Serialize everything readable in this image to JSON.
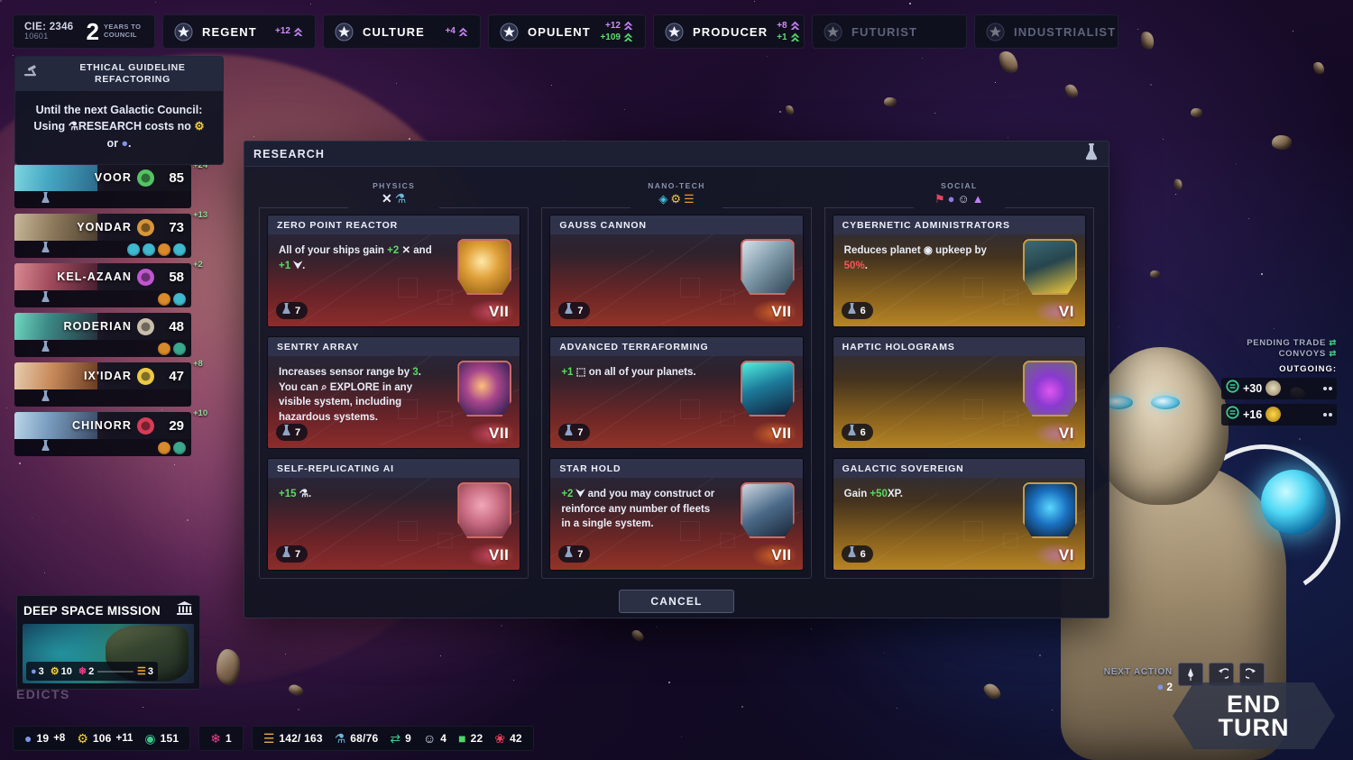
{
  "top_bar": {
    "turn_box": {
      "cie_label": "CIE: 2346",
      "cie_sub": "10601",
      "years_number": "2",
      "years_label_line1": "YEARS TO",
      "years_label_line2": "COUNCIL"
    },
    "seats": [
      {
        "label": "REGENT",
        "gain_primary": "+12",
        "gain_secondary": "",
        "active": true
      },
      {
        "label": "CULTURE",
        "gain_primary": "+4",
        "gain_secondary": "",
        "active": true
      },
      {
        "label": "OPULENT",
        "gain_primary": "+12",
        "gain_secondary": "+109",
        "active": true
      },
      {
        "label": "PRODUCER",
        "gain_primary": "+8",
        "gain_secondary": "+1",
        "active": true
      },
      {
        "label": "FUTURIST",
        "gain_primary": "",
        "gain_secondary": "",
        "active": false
      },
      {
        "label": "INDUSTRIALIST",
        "gain_primary": "",
        "gain_secondary": "",
        "active": false
      }
    ]
  },
  "ethical_panel": {
    "icon": "gavel-icon",
    "title": "ETHICAL GUIDELINE REFACTORING",
    "line1": "Until the next Galactic Council:",
    "line2_pre": "Using ",
    "line2_token": "RESEARCH",
    "line2_post": " costs no ",
    "line3": "or"
  },
  "civilizations": [
    {
      "name": "VOOR",
      "score": "85",
      "delta": "+24",
      "emblem_color": "#5ad36a",
      "portrait": "voor",
      "icons": []
    },
    {
      "name": "YONDAR",
      "score": "73",
      "delta": "+13",
      "emblem_color": "#e8a23c",
      "portrait": "yondar",
      "icons": [
        "#3fb9cf",
        "#3fb9cf",
        "#d98b2c",
        "#3fb9cf"
      ]
    },
    {
      "name": "KEL-AZAAN",
      "score": "58",
      "delta": "+2",
      "emblem_color": "#d05ce0",
      "portrait": "kelazaan",
      "icons": [
        "#d98b2c",
        "#3fb9cf"
      ]
    },
    {
      "name": "RODERIAN",
      "score": "48",
      "delta": "",
      "emblem_color": "#d9cdb5",
      "portrait": "roderian",
      "icons": [
        "#d98b2c",
        "#3aa88c"
      ]
    },
    {
      "name": "IX'IDAR",
      "score": "47",
      "delta": "+8",
      "emblem_color": "#ffd94a",
      "portrait": "ixidar",
      "icons": []
    },
    {
      "name": "CHINORR",
      "score": "29",
      "delta": "+10",
      "emblem_color": "#e8405c",
      "portrait": "chinorr",
      "icons": [
        "#d98b2c",
        "#3aa88c"
      ]
    }
  ],
  "research": {
    "header_title": "RESEARCH",
    "header_icon": "flask-icon",
    "cancel_label": "CANCEL",
    "columns": [
      {
        "label": "PHYSICS",
        "icons": [
          "attack-icon",
          "flask-icon"
        ],
        "theme": "physics",
        "cards": [
          {
            "title": "ZERO POINT REACTOR",
            "desc_parts": [
              {
                "t": "All of your ships gain ",
                "c": "w"
              },
              {
                "t": "+2",
                "c": "g"
              },
              {
                "t": " ✕ and ",
                "c": "w"
              },
              {
                "t": "+1",
                "c": "g"
              },
              {
                "t": " ⮟.",
                "c": "w"
              }
            ],
            "cost": "7",
            "tier": "VII",
            "art": "atom-icon"
          },
          {
            "title": "SENTRY ARRAY",
            "desc_parts": [
              {
                "t": "Increases sensor range by ",
                "c": "w"
              },
              {
                "t": "3",
                "c": "g"
              },
              {
                "t": ". You can ⌕ EXPLORE in any visible system, including hazardous systems.",
                "c": "w"
              }
            ],
            "cost": "7",
            "tier": "VII",
            "art": "galaxy-icon"
          },
          {
            "title": "SELF-REPLICATING AI",
            "desc_parts": [
              {
                "t": "+15",
                "c": "g"
              },
              {
                "t": " ⚗.",
                "c": "w"
              }
            ],
            "cost": "7",
            "tier": "VII",
            "art": "brain-icon"
          }
        ]
      },
      {
        "label": "NANO-TECH",
        "icons": [
          "droplet-icon",
          "gear-icon",
          "wave-icon"
        ],
        "theme": "nano",
        "cards": [
          {
            "title": "GAUSS CANNON",
            "desc_parts": [],
            "cost": "7",
            "tier": "VII",
            "art": "cannon-icon"
          },
          {
            "title": "ADVANCED TERRAFORMING",
            "desc_parts": [
              {
                "t": "+1",
                "c": "g"
              },
              {
                "t": " ⬚ on all of your planets.",
                "c": "w"
              }
            ],
            "cost": "7",
            "tier": "VII",
            "art": "terraform-icon"
          },
          {
            "title": "STAR HOLD",
            "desc_parts": [
              {
                "t": "+2",
                "c": "g"
              },
              {
                "t": " ⮟ and you may construct or reinforce any number of fleets in a single system.",
                "c": "w"
              }
            ],
            "cost": "7",
            "tier": "VII",
            "art": "starbase-icon"
          }
        ]
      },
      {
        "label": "SOCIAL",
        "icons": [
          "flag-icon",
          "mask-icon",
          "theater-icon",
          "influence-icon"
        ],
        "theme": "social",
        "cards": [
          {
            "title": "CYBERNETIC ADMINISTRATORS",
            "desc_parts": [
              {
                "t": "Reduces planet ◉ upkeep by ",
                "c": "w"
              },
              {
                "t": "50%",
                "c": "r"
              },
              {
                "t": ".",
                "c": "w"
              }
            ],
            "cost": "6",
            "tier": "VI",
            "art": "administrators-icon"
          },
          {
            "title": "HAPTIC HOLOGRAMS",
            "desc_parts": [],
            "cost": "6",
            "tier": "VI",
            "art": "hologram-icon"
          },
          {
            "title": "GALACTIC SOVEREIGN",
            "desc_parts": [
              {
                "t": "Gain ",
                "c": "w"
              },
              {
                "t": "+50",
                "c": "g"
              },
              {
                "t": "XP.",
                "c": "w"
              }
            ],
            "cost": "6",
            "tier": "VI",
            "art": "sovereign-icon"
          }
        ]
      }
    ]
  },
  "trade_convoys": {
    "title_line1": "PENDING TRADE",
    "title_line2": "CONVOYS",
    "outgoing_label": "OUTGOING:",
    "rows": [
      {
        "value": "+30",
        "faction_emblem": "roderian",
        "dots": 2
      },
      {
        "value": "+16",
        "faction_emblem": "ixidar",
        "dots": 2
      }
    ]
  },
  "mission": {
    "title": "DEEP SPACE MISSION",
    "icon": "bank-icon",
    "costs": [
      {
        "icon": "influence-icon",
        "value": "3"
      },
      {
        "icon": "credits-icon",
        "value": "10"
      },
      {
        "icon": "gem-icon",
        "value": "2"
      }
    ],
    "reward": {
      "icon": "resource-icon",
      "value": "3"
    }
  },
  "edicts_label": "EDICTS",
  "bottom_bar": {
    "group1": [
      {
        "icon": "influence-icon",
        "value": "19",
        "delta": "+8"
      },
      {
        "icon": "credits-icon",
        "value": "106",
        "delta": "+11"
      },
      {
        "icon": "trade-icon",
        "value": "151",
        "delta": ""
      }
    ],
    "group2": [
      {
        "icon": "gem-icon",
        "value": "1",
        "delta": ""
      }
    ],
    "group3": [
      {
        "icon": "minerals-icon",
        "value": "142/ 163",
        "delta": ""
      },
      {
        "icon": "research-icon",
        "value": "68/76",
        "delta": ""
      },
      {
        "icon": "exchange-icon",
        "value": "9",
        "delta": ""
      },
      {
        "icon": "approval-icon",
        "value": "4",
        "delta": ""
      },
      {
        "icon": "food-icon",
        "value": "22",
        "delta": ""
      },
      {
        "icon": "military-icon",
        "value": "42",
        "delta": ""
      }
    ]
  },
  "end_turn": {
    "next_action_label": "NEXT ACTION",
    "next_action_icon": "influence-icon",
    "next_action_count": "2",
    "buttons": [
      "ship-icon",
      "undo-icon",
      "redo-icon"
    ],
    "label_line1": "END",
    "label_line2": "TURN"
  },
  "colors": {
    "accent_green": "#57dc63",
    "accent_red": "#f05a5a",
    "accent_purple": "#cf8ef4",
    "panel_bg": "#0e101c",
    "card_title_bg": "#30344c"
  }
}
